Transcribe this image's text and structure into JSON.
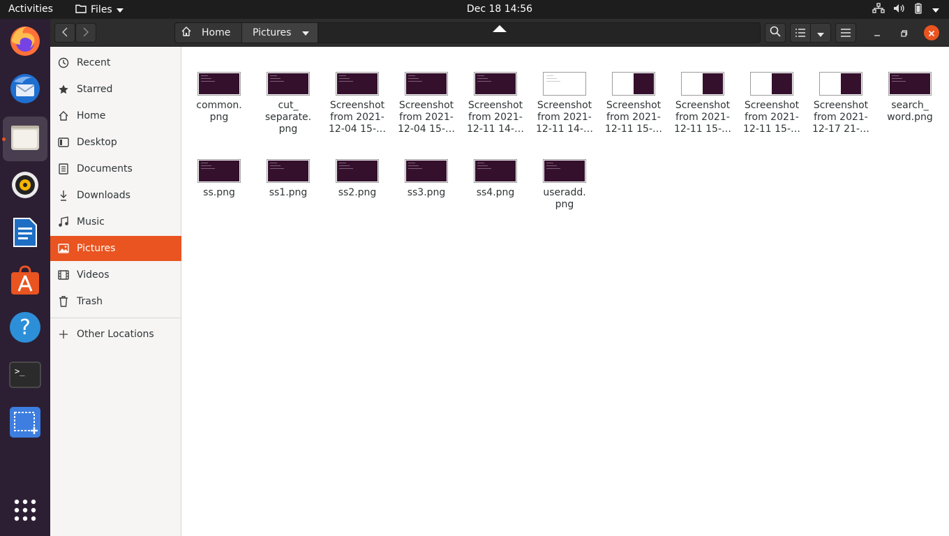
{
  "topbar": {
    "activities": "Activities",
    "app_name": "Files",
    "clock": "Dec 18  14:56"
  },
  "dock": {
    "items": [
      "firefox-icon",
      "thunderbird-icon",
      "files-icon",
      "rhythmbox-icon",
      "libreoffice-writer-icon",
      "app-center-icon",
      "help-icon",
      "terminal-icon",
      "screenshot-icon",
      "show-apps-icon"
    ]
  },
  "pathbar": {
    "home": "Home",
    "current": "Pictures"
  },
  "sidebar": {
    "items": [
      {
        "label": "Recent",
        "icon": "clock-icon"
      },
      {
        "label": "Starred",
        "icon": "star-icon"
      },
      {
        "label": "Home",
        "icon": "home-icon"
      },
      {
        "label": "Desktop",
        "icon": "desktop-icon"
      },
      {
        "label": "Documents",
        "icon": "document-icon"
      },
      {
        "label": "Downloads",
        "icon": "download-icon"
      },
      {
        "label": "Music",
        "icon": "music-icon"
      },
      {
        "label": "Pictures",
        "icon": "picture-icon"
      },
      {
        "label": "Videos",
        "icon": "video-icon"
      },
      {
        "label": "Trash",
        "icon": "trash-icon"
      }
    ],
    "other_locations": "Other Locations"
  },
  "files": [
    {
      "name": "common.\npng",
      "thumb": "dark"
    },
    {
      "name": "cut_\nseparate.\npng",
      "thumb": "dark"
    },
    {
      "name": "Screenshot\nfrom 2021-\n12-04 15-…",
      "thumb": "dark"
    },
    {
      "name": "Screenshot\nfrom 2021-\n12-04 15-…",
      "thumb": "dark"
    },
    {
      "name": "Screenshot\nfrom 2021-\n12-11 14-…",
      "thumb": "dark"
    },
    {
      "name": "Screenshot\nfrom 2021-\n12-11 14-…",
      "thumb": "light"
    },
    {
      "name": "Screenshot\nfrom 2021-\n12-11 15-…",
      "thumb": "split"
    },
    {
      "name": "Screenshot\nfrom 2021-\n12-11 15-…",
      "thumb": "split"
    },
    {
      "name": "Screenshot\nfrom 2021-\n12-11 15-…",
      "thumb": "split"
    },
    {
      "name": "Screenshot\nfrom 2021-\n12-17 21-…",
      "thumb": "split"
    },
    {
      "name": "search_\nword.png",
      "thumb": "dark"
    },
    {
      "name": "ss.png",
      "thumb": "dark"
    },
    {
      "name": "ss1.png",
      "thumb": "dark"
    },
    {
      "name": "ss2.png",
      "thumb": "dark"
    },
    {
      "name": "ss3.png",
      "thumb": "dark"
    },
    {
      "name": "ss4.png",
      "thumb": "dark"
    },
    {
      "name": "useradd.\npng",
      "thumb": "dark"
    }
  ],
  "colors": {
    "accent": "#e95420",
    "dock_bg": "#2c1f33",
    "topbar_bg": "#1d1d1d",
    "terminal_thumb": "#35102d"
  }
}
